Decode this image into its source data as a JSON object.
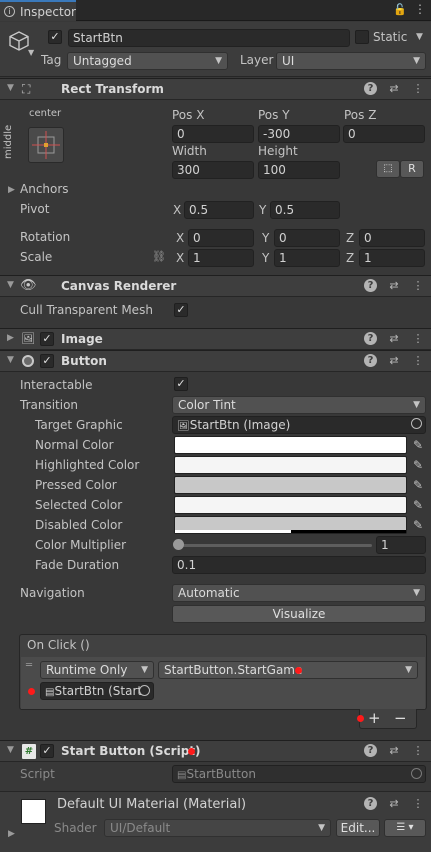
{
  "tab": {
    "label": "Inspector"
  },
  "object": {
    "name": "StartBtn",
    "static_label": "Static",
    "tag_label": "Tag",
    "tag_value": "Untagged",
    "layer_label": "Layer",
    "layer_value": "UI"
  },
  "rect_transform": {
    "title": "Rect Transform",
    "anchor_preset_top": "center",
    "anchor_preset_side": "middle",
    "pos_x_label": "Pos X",
    "pos_x": "0",
    "pos_y_label": "Pos Y",
    "pos_y": "-300",
    "pos_z_label": "Pos Z",
    "pos_z": "0",
    "width_label": "Width",
    "width": "300",
    "height_label": "Height",
    "height": "100",
    "r_button": "R",
    "anchors_label": "Anchors",
    "pivot_label": "Pivot",
    "pivot_x": "0.5",
    "pivot_y": "0.5",
    "rotation_label": "Rotation",
    "rot_x": "0",
    "rot_y": "0",
    "rot_z": "0",
    "scale_label": "Scale",
    "scale_x": "1",
    "scale_y": "1",
    "scale_z": "1",
    "x": "X",
    "y": "Y",
    "z": "Z"
  },
  "canvas_renderer": {
    "title": "Canvas Renderer",
    "cull_label": "Cull Transparent Mesh"
  },
  "image": {
    "title": "Image"
  },
  "button": {
    "title": "Button",
    "interactable_label": "Interactable",
    "transition_label": "Transition",
    "transition_value": "Color Tint",
    "target_graphic_label": "Target Graphic",
    "target_graphic_value": "StartBtn (Image)",
    "normal_color_label": "Normal Color",
    "highlighted_color_label": "Highlighted Color",
    "pressed_color_label": "Pressed Color",
    "selected_color_label": "Selected Color",
    "disabled_color_label": "Disabled Color",
    "color_multiplier_label": "Color Multiplier",
    "color_multiplier_value": "1",
    "fade_duration_label": "Fade Duration",
    "fade_duration_value": "0.1",
    "navigation_label": "Navigation",
    "navigation_value": "Automatic",
    "visualize_label": "Visualize",
    "colors": {
      "normal": "#ffffff",
      "highlighted": "#f5f5f5",
      "pressed": "#c8c8c8",
      "selected": "#f5f5f5",
      "disabled": "#c8c8c8"
    }
  },
  "on_click": {
    "title": "On Click ()",
    "runtime_value": "Runtime Only",
    "function_value": "StartButton.StartGame",
    "object_value": "StartBtn (Start",
    "plus": "+",
    "minus": "−"
  },
  "script_component": {
    "title": "Start Button (Script)",
    "script_label": "Script",
    "script_value": "StartButton"
  },
  "material": {
    "title": "Default UI Material (Material)",
    "shader_label": "Shader",
    "shader_value": "UI/Default",
    "edit_label": "Edit..."
  },
  "accent_colors": {
    "tab_highlight": "#3a79bb",
    "marker_red": "#ff1a1a"
  }
}
